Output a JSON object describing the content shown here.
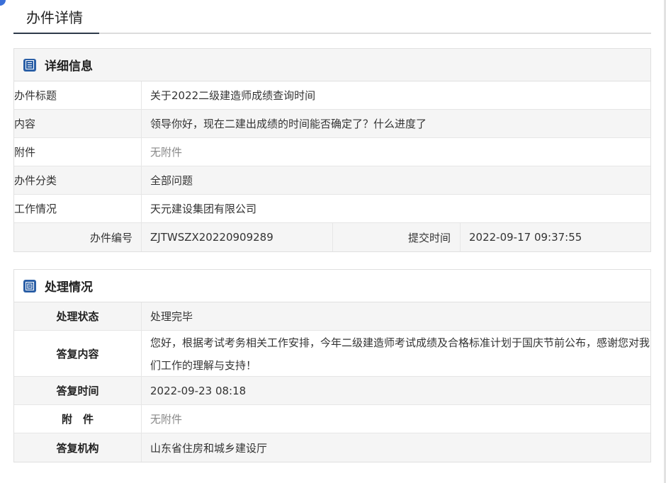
{
  "page": {
    "title": "办件详情"
  },
  "detail": {
    "heading": "详细信息",
    "rows": [
      {
        "label": "办件标题",
        "value": "关于2022二级建造师成绩查询时间"
      },
      {
        "label": "内容",
        "value": "领导你好，现在二建出成绩的时间能否确定了？什么进度了"
      },
      {
        "label": "附件",
        "value": "无附件"
      },
      {
        "label": "办件分类",
        "value": "全部问题"
      },
      {
        "label": "工作情况",
        "value": "天元建设集团有限公司"
      }
    ],
    "code_label": "办件编号",
    "code_value": "ZJTWSZX20220909289",
    "time_label": "提交时间",
    "time_value": "2022-09-17 09:37:55"
  },
  "processing": {
    "heading": "处理情况",
    "status_label": "处理状态",
    "status_value": "处理完毕",
    "reply_label": "答复内容",
    "reply_value": "您好，根据考试考务相关工作安排，今年二级建造师考试成绩及合格标准计划于国庆节前公布，感谢您对我们工作的理解与支持！",
    "reply_time_label": "答复时间",
    "reply_time_value": "2022-09-23 08:18",
    "attach_label": "附　件",
    "attach_value": "无附件",
    "org_label": "答复机构",
    "org_value": "山东省住房和城乡建设厅"
  }
}
